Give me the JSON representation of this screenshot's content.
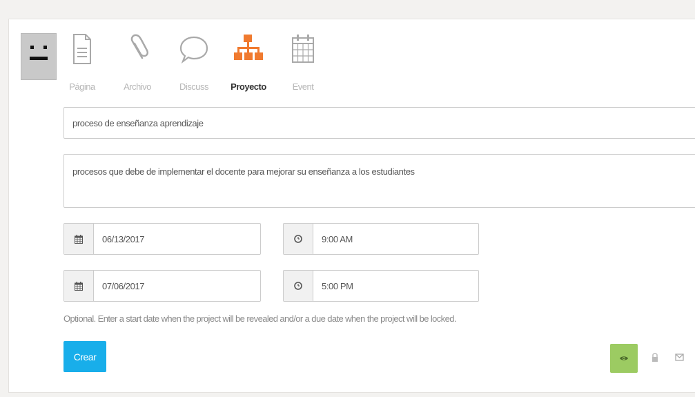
{
  "tabs": [
    {
      "label": "Página",
      "icon": "page-icon",
      "active": false
    },
    {
      "label": "Archivo",
      "icon": "paperclip-icon",
      "active": false
    },
    {
      "label": "Discuss",
      "icon": "speech-bubble-icon",
      "active": false
    },
    {
      "label": "Proyecto",
      "icon": "org-chart-icon",
      "active": true
    },
    {
      "label": "Event",
      "icon": "calendar-icon",
      "active": false
    }
  ],
  "form": {
    "title_value": "proceso de enseñanza aprendizaje",
    "description_value": "procesos que debe de implementar el docente para mejorar su enseñanza a los estudiantes",
    "start_date": "06/13/2017",
    "start_time": "9:00 AM",
    "due_date": "07/06/2017",
    "due_time": "5:00 PM",
    "help_text": "Optional. Enter a start date when the project will be revealed and/or a due date when the project will be locked.",
    "submit_label": "Crear"
  },
  "icons": {
    "date_addon": "calendar-icon",
    "time_addon": "clock-icon",
    "visibility": "eye-icon",
    "lock": "lock-icon",
    "mail": "mail-icon"
  },
  "colors": {
    "active_tab_icon": "#f07a2f",
    "inactive_tab_icon": "#a9a9a9",
    "submit_button": "#18aeea",
    "visibility_button": "#9ccb62"
  }
}
